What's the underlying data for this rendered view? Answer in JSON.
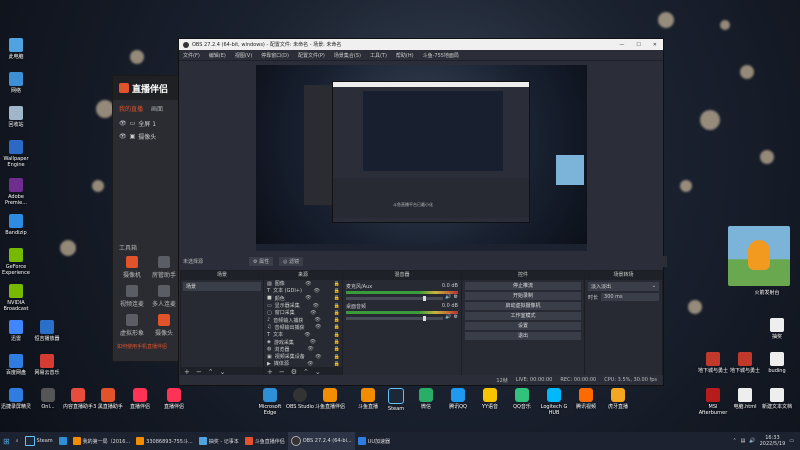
{
  "desktop_icons_left": [
    {
      "label": "此电脑",
      "color": "#4fa3e0"
    },
    {
      "label": "网络",
      "color": "#3d8fd6"
    },
    {
      "label": "回收站",
      "color": "#9fb7c9"
    },
    {
      "label": "Wallpaper Engine",
      "color": "#2b69c4"
    },
    {
      "label": "Adobe Premie...",
      "color": "#6f2d8d"
    },
    {
      "label": "Bandizip",
      "color": "#2f8be0"
    },
    {
      "label": "GeForce Experience",
      "color": "#76b900"
    },
    {
      "label": "NVIDIA Broadcast",
      "color": "#76b900"
    },
    {
      "label": "迅雷",
      "color": "#3f86ff"
    },
    {
      "label": "恒吉播放器",
      "color": "#2a6fc9"
    },
    {
      "label": "百度网盘",
      "color": "#2f7de1"
    },
    {
      "label": "网易云音乐",
      "color": "#d43c33"
    }
  ],
  "desktop_icons_bottom": [
    {
      "label": "迅捷录屏精灵",
      "color": "#2f7de1"
    },
    {
      "label": "Onl...",
      "color": "#555"
    },
    {
      "label": "内容直播助手",
      "color": "#e74c3c"
    },
    {
      "label": "3 黑直播助手",
      "color": "#e2522b"
    },
    {
      "label": "直播伴侣",
      "color": "#ff3355"
    },
    {
      "label": "直播伴侣",
      "color": "#ff3355"
    },
    {
      "label": "Microsoft Edge",
      "color": "#2d8fd6"
    },
    {
      "label": "OBS Studio",
      "color": "#333"
    },
    {
      "label": "斗鱼直播伴侣",
      "color": "#f28c00"
    },
    {
      "label": "斗鱼直播",
      "color": "#f28c00"
    },
    {
      "label": "Steam",
      "color": "#1b2838"
    },
    {
      "label": "微信",
      "color": "#2aae67"
    },
    {
      "label": "腾讯QQ",
      "color": "#1e9bf0"
    },
    {
      "label": "YY语音",
      "color": "#f7c400"
    },
    {
      "label": "QQ音乐",
      "color": "#31c27c"
    },
    {
      "label": "Logitech G HUB",
      "color": "#00b8fc"
    },
    {
      "label": "腾讯视频",
      "color": "#ff6a00"
    },
    {
      "label": "虎牙直播",
      "color": "#f5a623"
    }
  ],
  "desktop_icons_right": [
    {
      "label": "火箭发射台",
      "color": "#e88a1f"
    },
    {
      "label": "抽奖",
      "color": "#ddd"
    },
    {
      "label": "地下城与勇士",
      "color": "#c0392b"
    },
    {
      "label": "地下城与勇士",
      "color": "#c0392b"
    },
    {
      "label": "buding",
      "color": "#eee"
    },
    {
      "label": "MSI Afterburner",
      "color": "#b71c1c"
    },
    {
      "label": "电脑.html",
      "color": "#eee"
    },
    {
      "label": "新建文本文档",
      "color": "#eee"
    }
  ],
  "live_app": {
    "brand": "直播伴侣",
    "tabs": [
      "我的直播",
      "画面"
    ],
    "scenes": [
      {
        "label": "全屏 1"
      },
      {
        "label": "摄像头"
      }
    ],
    "tools_header": "工具箱",
    "tools": [
      {
        "label": "摄像机",
        "active": true
      },
      {
        "label": "房管助手",
        "active": false
      },
      {
        "label": "视频连麦",
        "active": false
      },
      {
        "label": "多人连麦",
        "active": false
      },
      {
        "label": "虚拟形象",
        "active": false
      },
      {
        "label": "摄像头",
        "active": true
      }
    ],
    "footer": "如何使用手机直播伴侣"
  },
  "obs": {
    "title": "OBS 27.2.4 (64-bit, windows) - 配置文件: 未命名 - 场景: 未命名",
    "menu": [
      "文件(F)",
      "编辑(E)",
      "视图(V)",
      "停靠窗口(D)",
      "配置文件(P)",
      "场景集合(S)",
      "工具(T)",
      "帮助(H)",
      "斗鱼-755地面局"
    ],
    "no_source": "未选择源",
    "props_btn": "属性",
    "filters_btn": "滤镜",
    "docks": {
      "scenes": {
        "title": "场景",
        "items": [
          "场景"
        ]
      },
      "sources": {
        "title": "来源",
        "items": [
          "图像",
          "文本 (GDI+)",
          "颜色",
          "显示器采集",
          "窗口采集",
          "音频输入捕获",
          "音频输出捕获",
          "文本",
          "游戏采集",
          "浏览器",
          "视频采集设备",
          "媒体源"
        ]
      },
      "mixer": {
        "title": "混音器",
        "channels": [
          {
            "name": "麦克风/Aux",
            "db": "0.0 dB"
          },
          {
            "name": "桌面音频",
            "db": "0.0 dB"
          }
        ]
      },
      "transitions": {
        "title": "场景转场",
        "type": "淡入淡出",
        "duration_label": "时长",
        "duration": "300 ms"
      },
      "controls": {
        "title": "控件",
        "buttons": [
          "停止推流",
          "开始录制",
          "启动虚拟摄像机",
          "工作室模式",
          "设置",
          "退出"
        ]
      }
    },
    "status": {
      "live": "00:00:00",
      "rec": "00:00:00",
      "cpu": "CPU: 3.5%, 30.00 fps",
      "frames": "12帧"
    },
    "preview_inner_caption": "斗鱼直播平台已最小化"
  },
  "taskbar": {
    "items": [
      {
        "label": "Steam",
        "color": "#1b2838"
      },
      {
        "label": "我的第一局（2016...",
        "color": "#f28c00"
      },
      {
        "label": "33086893-755斗...",
        "color": "#f28c00"
      },
      {
        "label": "抽奖 - 记事本",
        "color": "#4fa3e0"
      },
      {
        "label": "斗鱼直播伴侣",
        "color": "#e2522b"
      },
      {
        "label": "OBS 27.2.4 (64-bi...",
        "color": "#333"
      },
      {
        "label": "UU加速器",
        "color": "#2f7de1"
      }
    ],
    "time": "16:33",
    "date": "2022/5/19"
  },
  "colors": {
    "accent": "#e2522b",
    "obs_bg": "#2b2e38"
  }
}
